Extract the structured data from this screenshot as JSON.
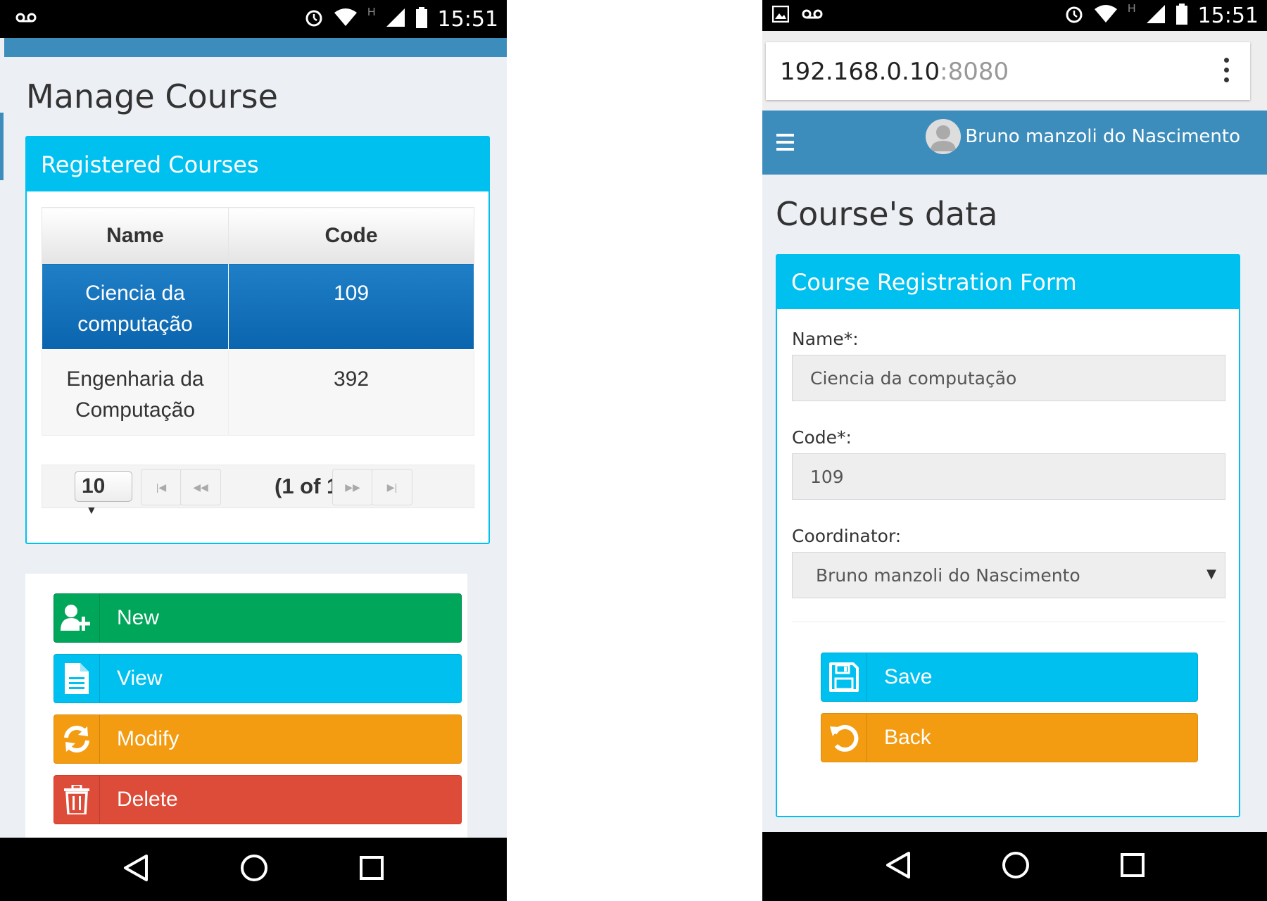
{
  "status_bar": {
    "time_left": "15:51",
    "time_right": "15:51",
    "network": "H"
  },
  "left": {
    "page_title": "Manage Course",
    "box_title": "Registered Courses",
    "table": {
      "columns": [
        "Name",
        "Code"
      ],
      "rows": [
        {
          "name": "Ciencia da computação",
          "code": "109",
          "selected": true
        },
        {
          "name": "Engenharia da Computação",
          "code": "392",
          "selected": false
        }
      ]
    },
    "paginator": {
      "rows_per_page": "10",
      "report": "(1 of 1)"
    },
    "actions": {
      "new_label": "New",
      "view_label": "View",
      "modify_label": "Modify",
      "delete_label": "Delete"
    }
  },
  "right": {
    "url_host": "192.168.0.10",
    "url_port": ":8080",
    "user_name": "Bruno manzoli do Nascimento",
    "page_title": "Course's data",
    "form_title": "Course Registration Form",
    "fields": {
      "name_label": "Name*:",
      "name_value": "Ciencia da computação",
      "code_label": "Code*:",
      "code_value": "109",
      "coordinator_label": "Coordinator:",
      "coordinator_value": "Bruno manzoli do Nascimento"
    },
    "save_label": "Save",
    "back_label": "Back"
  },
  "colors": {
    "primary": "#3c8dbc",
    "info": "#00c0ef",
    "success": "#00a65a",
    "warning": "#f39c12",
    "danger": "#dd4b39"
  },
  "icons": [
    "voicemail-icon",
    "alarm-icon",
    "wifi-icon",
    "signal-icon",
    "battery-icon",
    "image-icon",
    "add-user-icon",
    "document-icon",
    "refresh-icon",
    "trash-icon",
    "save-icon",
    "undo-icon",
    "menu-icon",
    "more-icon",
    "back-nav-icon",
    "home-nav-icon",
    "recents-nav-icon"
  ]
}
